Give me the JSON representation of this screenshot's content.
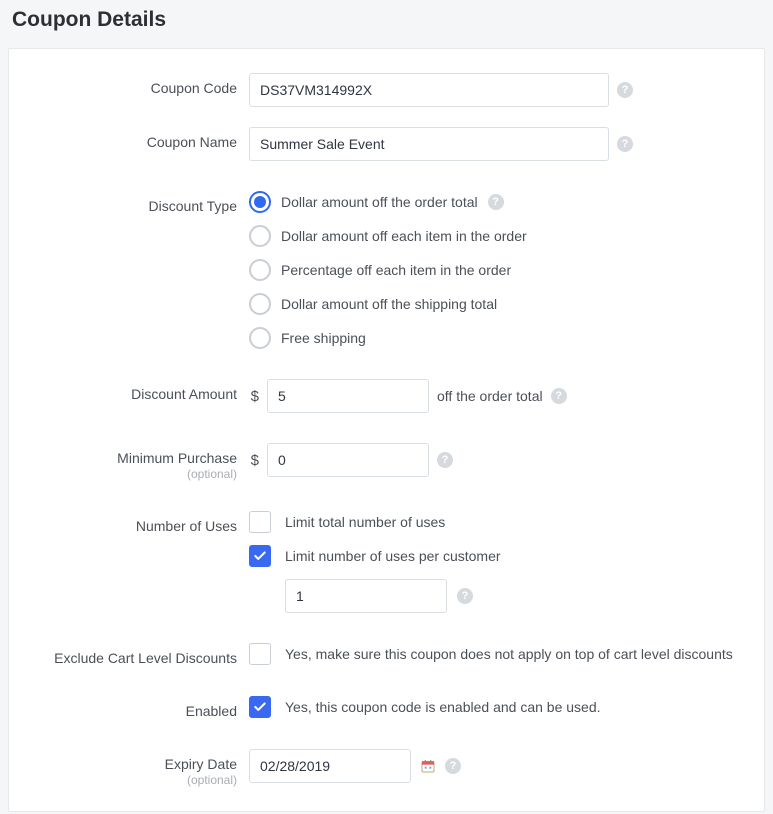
{
  "page_title": "Coupon Details",
  "labels": {
    "coupon_code": "Coupon Code",
    "coupon_name": "Coupon Name",
    "discount_type": "Discount Type",
    "discount_amount": "Discount Amount",
    "minimum_purchase": "Minimum Purchase",
    "optional": "(optional)",
    "number_of_uses": "Number of Uses",
    "exclude_cart": "Exclude Cart Level Discounts",
    "enabled": "Enabled",
    "expiry_date": "Expiry Date"
  },
  "fields": {
    "coupon_code": "DS37VM314992X",
    "coupon_name": "Summer Sale Event",
    "currency_symbol": "$",
    "discount_amount": "5",
    "discount_suffix": "off the order total",
    "minimum_purchase": "0",
    "per_customer_limit": "1",
    "expiry_date": "02/28/2019"
  },
  "discount_type_options": [
    "Dollar amount off the order total",
    "Dollar amount off each item in the order",
    "Percentage off each item in the order",
    "Dollar amount off the shipping total",
    "Free shipping"
  ],
  "checkbox_labels": {
    "limit_total": "Limit total number of uses",
    "limit_per_customer": "Limit number of uses per customer",
    "exclude_cart": "Yes, make sure this coupon does not apply on top of cart level discounts",
    "enabled": "Yes, this coupon code is enabled and can be used."
  },
  "help_icon_char": "?"
}
